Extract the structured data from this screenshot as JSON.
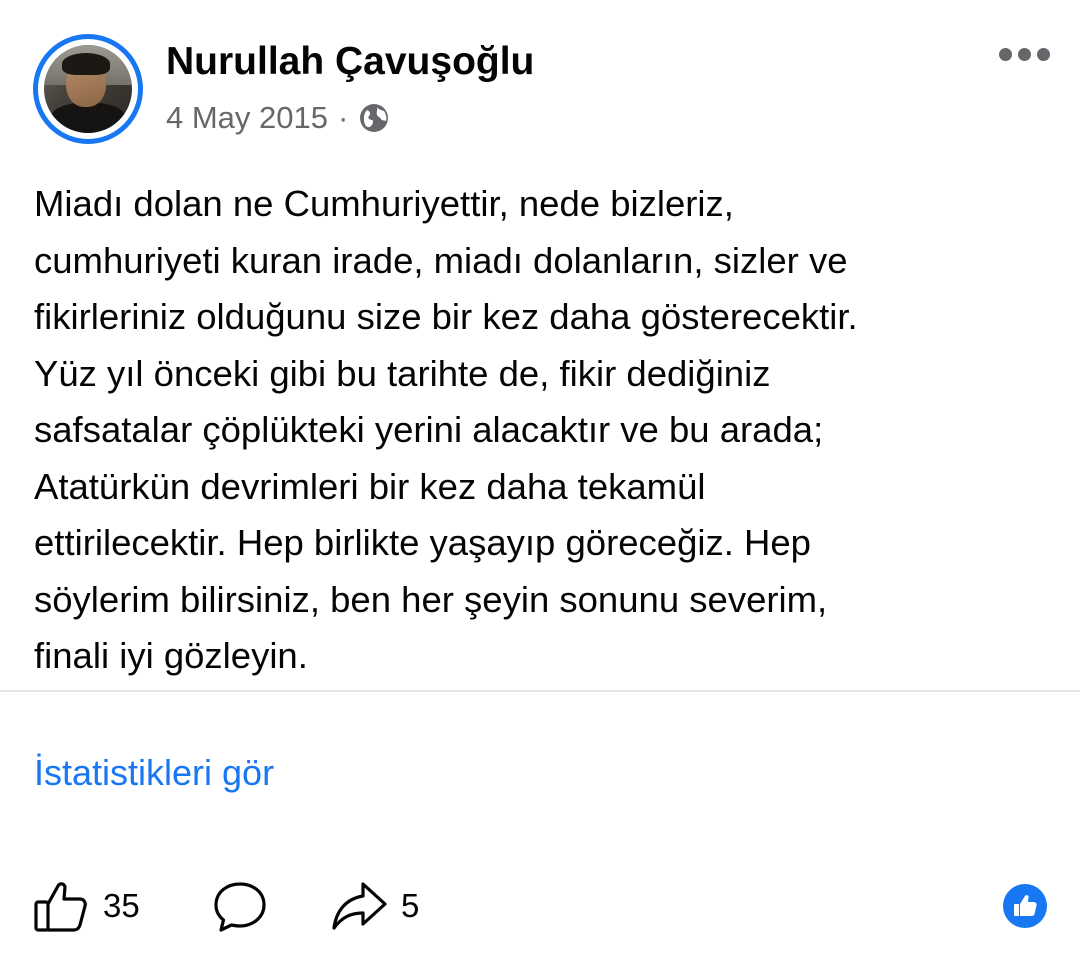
{
  "author": {
    "name": "Nurullah Çavuşoğlu",
    "avatar_icon": "user-avatar",
    "ring_color": "#1877f2"
  },
  "meta": {
    "date": "4 May 2015",
    "separator": "·",
    "privacy_icon": "globe-icon"
  },
  "menu_icon": "more-dots-icon",
  "post": {
    "text": "Miadı dolan ne Cumhuriyettir, nede bizleriz,\ncumhuriyeti kuran irade, miadı dolanların, sizler ve\nfikirleriniz olduğunu size bir kez daha gösterecektir.\nYüz yıl önceki gibi bu tarihte de, fikir dediğiniz\nsafsatalar çöplükteki yerini alacaktır ve bu arada;\nAtatürkün devrimleri bir kez daha tekamül\nettirilecektir. Hep birlikte yaşayıp göreceğiz. Hep\nsöylerim bilirsiniz, ben her şeyin sonunu severim,\nfinali iyi gözleyin."
  },
  "insights_link": "İstatistikleri gör",
  "actions": {
    "like": {
      "icon": "thumbs-up-icon",
      "count": "35"
    },
    "comment": {
      "icon": "comment-bubble-icon"
    },
    "share": {
      "icon": "share-arrow-icon",
      "count": "5"
    }
  },
  "reaction_badge": {
    "icon": "like-reaction-icon",
    "color": "#1877f2"
  }
}
